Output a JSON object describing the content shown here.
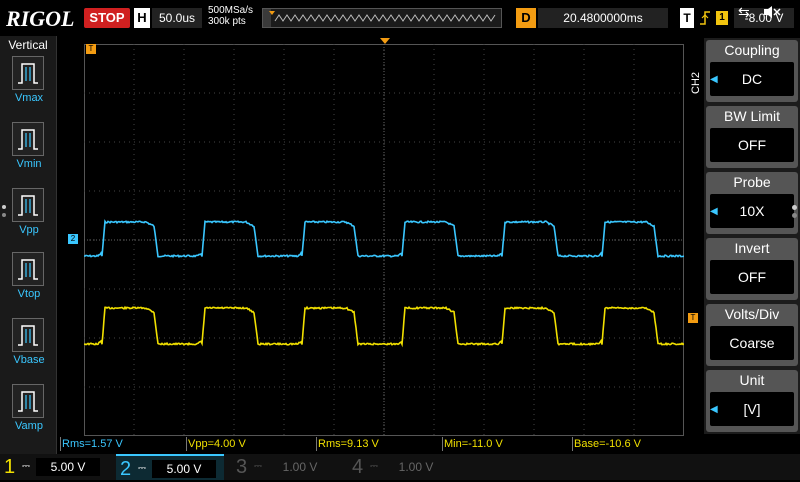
{
  "top": {
    "logo": "RIGOL",
    "run_state": "STOP",
    "h_label": "H",
    "timebase": "50.0us",
    "sample_rate": "500MSa/s",
    "memory_depth": "300k pts",
    "d_label": "D",
    "delay": "20.4800000ms",
    "t_label": "T",
    "trigger_source": "1",
    "trigger_level": "-8.00 V"
  },
  "left": {
    "title": "Vertical",
    "items": [
      {
        "label": "Vmax",
        "icon": "vmax-icon"
      },
      {
        "label": "Vmin",
        "icon": "vmin-icon"
      },
      {
        "label": "Vpp",
        "icon": "vpp-icon"
      },
      {
        "label": "Vtop",
        "icon": "vtop-icon"
      },
      {
        "label": "Vbase",
        "icon": "vbase-icon"
      },
      {
        "label": "Vamp",
        "icon": "vamp-icon"
      }
    ]
  },
  "right": {
    "channel_tag": "CH2",
    "buttons": [
      {
        "title": "Coupling",
        "value": "DC",
        "arrow": true
      },
      {
        "title": "BW Limit",
        "value": "OFF",
        "arrow": false
      },
      {
        "title": "Probe",
        "value": "10X",
        "arrow": true
      },
      {
        "title": "Invert",
        "value": "OFF",
        "arrow": false
      },
      {
        "title": "Volts/Div",
        "value": "Coarse",
        "arrow": false
      },
      {
        "title": "Unit",
        "value": "[V]",
        "arrow": true
      }
    ]
  },
  "measurements": [
    {
      "text": "Rms=1.57 V",
      "color": "#3ac7ff"
    },
    {
      "text": "Vpp=4.00 V",
      "color": "#f1e000"
    },
    {
      "text": "Rms=9.13 V",
      "color": "#f1e000"
    },
    {
      "text": "Min=-11.0 V",
      "color": "#f1e000"
    },
    {
      "text": "Base=-10.6 V",
      "color": "#f1e000"
    }
  ],
  "channels": [
    {
      "num": "1",
      "scale": "5.00 V",
      "color": "#f1e000",
      "active": false
    },
    {
      "num": "2",
      "scale": "5.00 V",
      "color": "#3ac7ff",
      "active": true
    },
    {
      "num": "3",
      "scale": "1.00 V",
      "color": "#c050c0",
      "active": false
    },
    {
      "num": "4",
      "scale": "1.00 V",
      "color": "#4a7bd0",
      "active": false
    }
  ],
  "markers": {
    "trigger_marker": "T",
    "ch2_marker": "2",
    "ch1_offset_marker": "T"
  },
  "colors": {
    "ch1": "#f1e000",
    "ch2": "#3ac7ff",
    "accent_orange": "#f39c12",
    "stop_red": "#d02020"
  }
}
